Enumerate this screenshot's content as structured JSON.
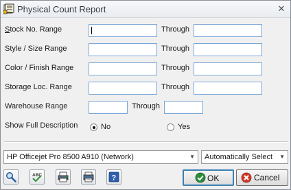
{
  "window": {
    "title": "Physical Count Report",
    "close_glyph": "✕"
  },
  "fields": {
    "stock_no": {
      "label": "Stock No. Range",
      "underline": "S",
      "rest": "tock No. Range",
      "through": "Through",
      "from_value": "",
      "to_value": ""
    },
    "style_size": {
      "label": "Style / Size Range",
      "through": "Through",
      "from_value": "",
      "to_value": ""
    },
    "color_finish": {
      "label": "Color / Finish Range",
      "through": "Through",
      "from_value": "",
      "to_value": ""
    },
    "storage_loc": {
      "label": "Storage Loc. Range",
      "through": "Through",
      "from_value": "",
      "to_value": ""
    },
    "warehouse": {
      "label": "Warehouse Range",
      "through": "Through",
      "from_value": "",
      "to_value": ""
    }
  },
  "show_full_description": {
    "label": "Show Full Description",
    "options": [
      {
        "label": "No",
        "checked": true
      },
      {
        "label": "Yes",
        "checked": false
      }
    ]
  },
  "printer": {
    "selected": "HP Officejet Pro 8500 A910 (Network)"
  },
  "tray": {
    "selected": "Automatically Select"
  },
  "toolbar": {
    "icons": [
      "magnifier-preview-icon",
      "spell-check-icon",
      "print-preview-icon",
      "printer-icon",
      "help-icon"
    ],
    "ok_label": "OK",
    "cancel_label": "Cancel"
  },
  "colors": {
    "field_border": "#7aa6d8",
    "ok_icon": "#2e8b3a",
    "cancel_icon": "#d23a2a",
    "default_button_border": "#3c7fb1"
  }
}
